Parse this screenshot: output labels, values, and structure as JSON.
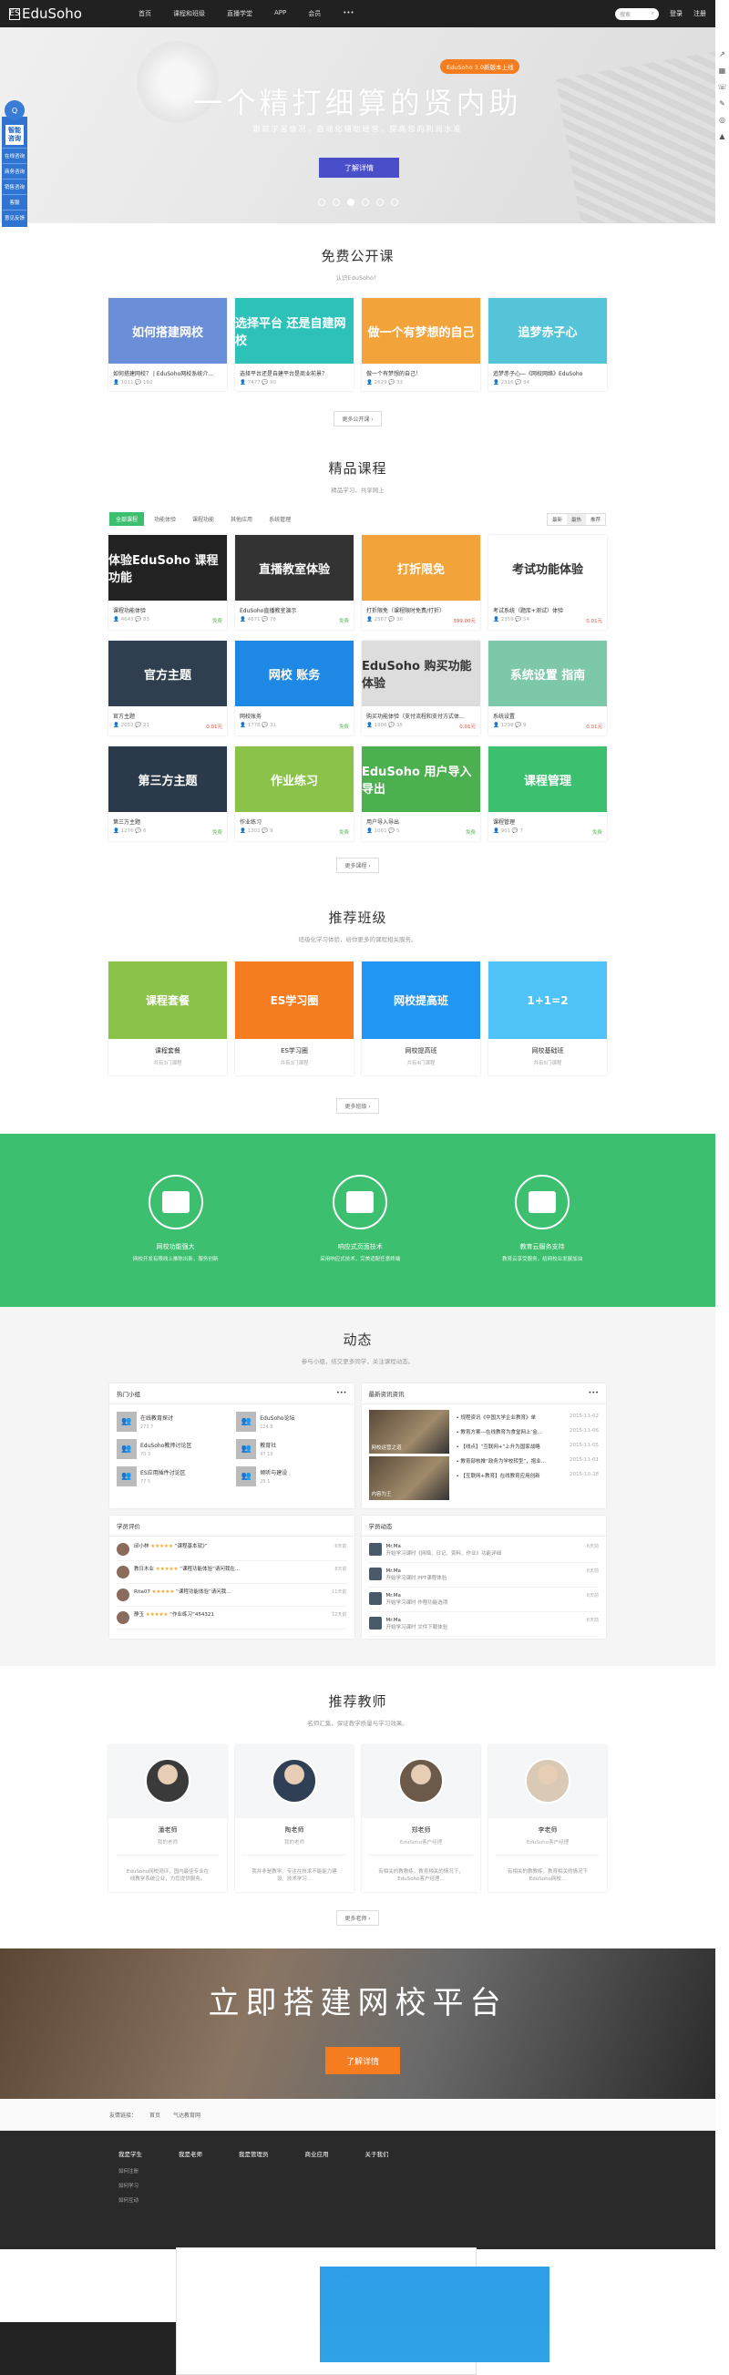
{
  "nav": {
    "logo": "EduSoho",
    "items": [
      "首页",
      "课程和班级",
      "直播学堂",
      "APP",
      "会员"
    ],
    "more": "•••",
    "search_placeholder": "搜索",
    "login": "登录",
    "register": "注册"
  },
  "hero": {
    "badge": "EduSoho 3.0新版本上线",
    "title": "一个精打细算的贤内助",
    "subtitle": "跟踪学習情况，自动化辅助经营，提高您的利润水准",
    "button": "了解详情"
  },
  "sidebar": {
    "circle": "Q",
    "title": "智能咨询",
    "items": [
      "在线咨询",
      "商务咨询",
      "销售咨询",
      "客服",
      "意见反馈"
    ]
  },
  "free": {
    "title": "免费公开课",
    "subtitle": "认识EduSoho！",
    "more": "更多公开课 ›",
    "cards": [
      {
        "thumb": "如何搭建网校",
        "title": "如何搭建网校？ | EduSoho网校系统介...",
        "m1": "1011",
        "m2": "102",
        "color": "#6a8fd8"
      },
      {
        "thumb": "选择平台 还是自建网校",
        "title": "选择平台还是自建平台是商业前景？",
        "m1": "7477",
        "m2": "90",
        "color": "#2ec1b8"
      },
      {
        "thumb": "做一个有梦想的自己",
        "title": "做一个有梦想的自己！",
        "m1": "2629",
        "m2": "33",
        "color": "#f2a33a"
      },
      {
        "thumb": "追梦赤子心",
        "title": "追梦赤子心—《网校网络》EduSoho",
        "m1": "2316",
        "m2": "34",
        "color": "#56c4d8"
      }
    ]
  },
  "quality": {
    "title": "精品课程",
    "subtitle": "精品学习，共享网上",
    "tabs": [
      "全部课程",
      "功能体验",
      "课程功能",
      "其他应用",
      "系统管理"
    ],
    "sorts": [
      "最新",
      "最热",
      "推荐"
    ],
    "more": "更多课程 ›",
    "cards": [
      {
        "thumb": "体验EduSoho 课程功能",
        "title": "课程功能体验",
        "m1": "4643",
        "m2": "83",
        "price": "免费",
        "color": "#222",
        "badge": "",
        "pc": "free"
      },
      {
        "thumb": "直播教室体验",
        "title": "EduSoho直播教室演示",
        "m1": "4671",
        "m2": "76",
        "price": "免费",
        "color": "#333",
        "badge": "",
        "pc": "free"
      },
      {
        "thumb": "打折限免",
        "title": "打折限免（课程限时免费/打折）",
        "m1": "2567",
        "m2": "36",
        "price": "399.00元",
        "color": "#f2a33a",
        "badge": "",
        "pc": "price"
      },
      {
        "thumb": "考试功能体验",
        "title": "考试系统（题库+测试）体验",
        "m1": "2359",
        "m2": "54",
        "price": "0.01元",
        "color": "#fff",
        "badge": "",
        "pc": "price"
      },
      {
        "thumb": "官方主题",
        "title": "官方主题",
        "m1": "2052",
        "m2": "21",
        "price": "0.01元",
        "color": "#2f3f4f",
        "badge": "",
        "pc": "price"
      },
      {
        "thumb": "网校 账务",
        "title": "网校账务",
        "m1": "1778",
        "m2": "31",
        "price": "免费",
        "color": "#1e88e5",
        "badge": "",
        "pc": "free"
      },
      {
        "thumb": "EduSoho 购买功能体验",
        "title": "购买功能体验（支付流程和支付方式体...",
        "m1": "1806",
        "m2": "35",
        "price": "0.01元",
        "color": "#ddd",
        "badge": "",
        "pc": "price"
      },
      {
        "thumb": "系统设置 指南",
        "title": "系统设置",
        "m1": "1298",
        "m2": "9",
        "price": "0.01元",
        "color": "#7cc8a8",
        "badge": "",
        "pc": "price"
      },
      {
        "thumb": "第三方主题",
        "title": "第三方主题",
        "m1": "1276",
        "m2": "6",
        "price": "免费",
        "color": "#2a3a4a",
        "badge": "",
        "pc": "free"
      },
      {
        "thumb": "作业练习",
        "title": "作业练习",
        "m1": "1302",
        "m2": "9",
        "price": "免费",
        "color": "#8bc34a",
        "badge": "",
        "pc": "free"
      },
      {
        "thumb": "EduSoho 用户导入导出",
        "title": "用户导入导出",
        "m1": "1061",
        "m2": "5",
        "price": "免费",
        "color": "#4caf50",
        "badge": "",
        "pc": "free"
      },
      {
        "thumb": "课程管理",
        "title": "课程管理",
        "m1": "901",
        "m2": "7",
        "price": "免费",
        "color": "#3cbf6e",
        "badge": "",
        "pc": "free"
      }
    ]
  },
  "classes": {
    "title": "推荐班级",
    "subtitle": "班级化学习体验，给你更多的课程相关服务。",
    "more": "更多班级 ›",
    "cards": [
      {
        "thumb": "课程套餐",
        "name": "课程套餐",
        "sub": "共有3门课程",
        "color": "#8bc34a"
      },
      {
        "thumb": "ES学习圈",
        "name": "ES学习圈",
        "sub": "共有3门课程",
        "color": "#f57c1f"
      },
      {
        "thumb": "网校提高班",
        "name": "网校提高班",
        "sub": "共有4门课程",
        "color": "#2196f3"
      },
      {
        "thumb": "1+1=2",
        "name": "网校基础班",
        "sub": "共有5门课程",
        "color": "#4fc3f7"
      }
    ]
  },
  "features": [
    {
      "a": "网校功能强大",
      "b": "网校开发有限线上推陈出新，服务创新"
    },
    {
      "a": "响应式页面技术",
      "b": "采用响应式技术，完美适配任意终端"
    },
    {
      "a": "教育云服务支持",
      "b": "教育云享受服务，给网校业发展加油"
    }
  ],
  "dynamic": {
    "title": "动态",
    "subtitle": "参与小组，结交更多同学，关注课程动态。",
    "groups_title": "热门小组",
    "groups": [
      {
        "n": "在线教育探讨",
        "a": "273",
        "b": "7"
      },
      {
        "n": "EduSoho论坛",
        "a": "124",
        "b": "8"
      },
      {
        "n": "EduSoho教师讨论区",
        "a": "70",
        "b": "3"
      },
      {
        "n": "教育社",
        "a": "47",
        "b": "19"
      },
      {
        "n": "ES应用插件讨论区",
        "a": "77",
        "b": "5"
      },
      {
        "n": "倾听与建设",
        "a": "25",
        "b": "1"
      }
    ],
    "news_title": "最新资讯资讯",
    "news_img1": "网校运营之道",
    "news_img2": "内容为王",
    "news": [
      {
        "t": "• 规程资讯《中国大学企业教育》单",
        "d": "2015-11-02"
      },
      {
        "t": "• 教育方案—在线教育为食堂网上‘金...",
        "d": "2015-11-06"
      },
      {
        "t": "• 【线点】“互联网+”上升为国家战略",
        "d": "2015-11-05"
      },
      {
        "t": "• 教育部核推“政务为学校转型”，抱业...",
        "d": "2015-11-01"
      },
      {
        "t": "• 【互联网+教育】在线教育应用创新",
        "d": "2015-10-28"
      }
    ],
    "reviews_title": "学员评价",
    "reviews": [
      {
        "u": "邱小林",
        "s": "★★★★★",
        "c": "“课程基本就》”",
        "tm": "6天前"
      },
      {
        "u": "教日木业",
        "s": "★★★★★",
        "c": "“课程功能体验”请问我在…",
        "tm": "8天前"
      },
      {
        "u": "Rita07",
        "s": "★★★★★",
        "c": "“课程功能体验”请问我…",
        "tm": "11天前"
      },
      {
        "u": "静玉",
        "s": "★★★★★",
        "c": "“作业练习”454321",
        "tm": "12天前"
      }
    ],
    "activity_title": "学员动态",
    "activities": [
      {
        "u": "Mr.Ma",
        "c": "开始学习课时《网络、日记、资料、作业》功能详细",
        "tm": "6天前"
      },
      {
        "u": "Mr.Ma",
        "c": "开始学习课时 PPT课程体验",
        "tm": "6天前"
      },
      {
        "u": "Mr.Ma",
        "c": "开始学习课时 作程功能选项",
        "tm": "6天前"
      },
      {
        "u": "Mr.Ma",
        "c": "开始学习课时 文件下载体验",
        "tm": "6天前"
      }
    ]
  },
  "teachers": {
    "title": "推荐教师",
    "subtitle": "名师汇集，保证教学质量与学习效果。",
    "more": "更多老师 ›",
    "cards": [
      {
        "n": "潘老师",
        "t": "我的老师",
        "d": "EduSoho网校测评，国内最佳专业在线教学系统企业，为您提供服务。"
      },
      {
        "n": "陶老师",
        "t": "我的老师",
        "d": "我并非是教学、专注在技术不能能力建设、技术学习..."
      },
      {
        "n": "郑老师",
        "t": "EduSoho客户经理",
        "d": "有相关的教教练，教育相关的情况下，EduSoho客户经理..."
      },
      {
        "n": "李老师",
        "t": "EduSoho客户经理",
        "d": "有相关的教教练，教育相关的情况下EduSoho网校..."
      }
    ]
  },
  "cta": {
    "title": "立即搭建网校平台",
    "button": "了解详情"
  },
  "friends": {
    "label": "友情链接：",
    "items": [
      "首页",
      "气达教育网"
    ]
  },
  "footer": {
    "cols": [
      {
        "h": "我是学生",
        "l": [
          "如何注册",
          "如何学习",
          "如何互动"
        ]
      },
      {
        "h": "我是老师",
        "l": []
      },
      {
        "h": "我是管理员",
        "l": []
      },
      {
        "h": "商业应用",
        "l": []
      },
      {
        "h": "关于我们",
        "l": []
      }
    ]
  }
}
